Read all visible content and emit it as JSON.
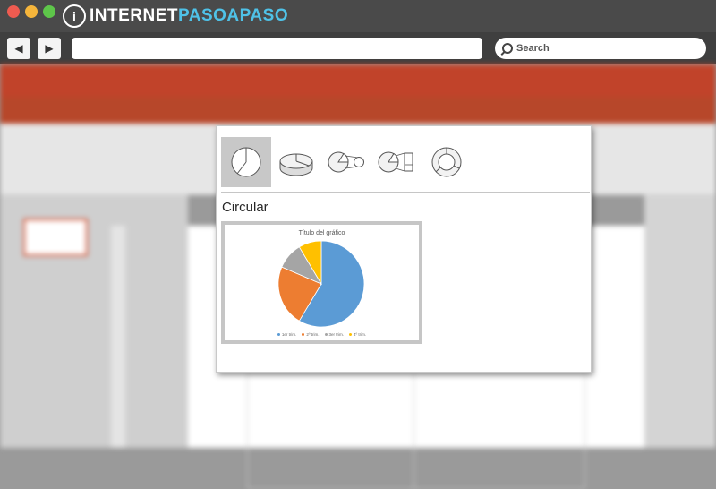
{
  "browser": {
    "logo_prefix": "INTERNET",
    "logo_suffix": "PASOAPASO",
    "search_placeholder": "Search",
    "back_icon": "◀",
    "forward_icon": "▶"
  },
  "gallery": {
    "chart_types": [
      {
        "name": "pie-2d",
        "selected": true
      },
      {
        "name": "pie-3d",
        "selected": false
      },
      {
        "name": "pie-of-pie",
        "selected": false
      },
      {
        "name": "bar-of-pie",
        "selected": false
      },
      {
        "name": "doughnut",
        "selected": false
      }
    ],
    "section_title": "Circular"
  },
  "chart_data": {
    "type": "pie",
    "title": "Título del gráfico",
    "categories": [
      "1er trim.",
      "2º trim.",
      "3er trim.",
      "4º trim."
    ],
    "values": [
      8.2,
      3.2,
      1.4,
      1.2
    ],
    "colors": [
      "#5b9bd5",
      "#ed7d31",
      "#a5a5a5",
      "#ffc000"
    ]
  }
}
